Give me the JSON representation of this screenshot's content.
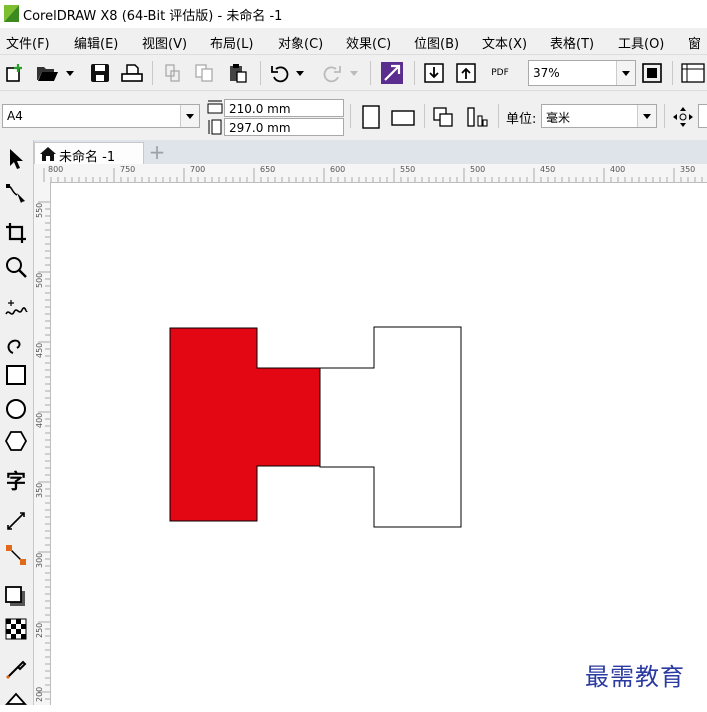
{
  "window": {
    "title": "CorelDRAW X8 (64-Bit 评估版) - 未命名 -1"
  },
  "menu": [
    "文件(F)",
    "编辑(E)",
    "视图(V)",
    "布局(L)",
    "对象(C)",
    "效果(C)",
    "位图(B)",
    "文本(X)",
    "表格(T)",
    "工具(O)",
    "窗"
  ],
  "toolbar": {
    "zoom_value": "37%",
    "pdf_label": "PDF"
  },
  "property_bar": {
    "page_size": "A4",
    "page_width": "210.0 mm",
    "page_height": "297.0 mm",
    "units_label": "单位:",
    "units_value": "毫米"
  },
  "document_tab": {
    "label": "未命名 -1"
  },
  "rulers": {
    "horizontal": [
      "800",
      "750",
      "700",
      "650",
      "600",
      "550",
      "500",
      "450",
      "400",
      "350"
    ],
    "vertical": [
      "550",
      "500",
      "450",
      "400",
      "350",
      "300",
      "250",
      "200"
    ]
  },
  "canvas_shapes": [
    {
      "name": "red-filled-shape",
      "fill": "#e30613",
      "stroke": "#000000"
    },
    {
      "name": "white-outline-shape",
      "fill": "#ffffff",
      "stroke": "#000000"
    }
  ],
  "colors": {
    "accent": "#e30613",
    "chrome": "#f0f0f0",
    "watermark": "#2b3aa0"
  },
  "watermark": "最需教育"
}
